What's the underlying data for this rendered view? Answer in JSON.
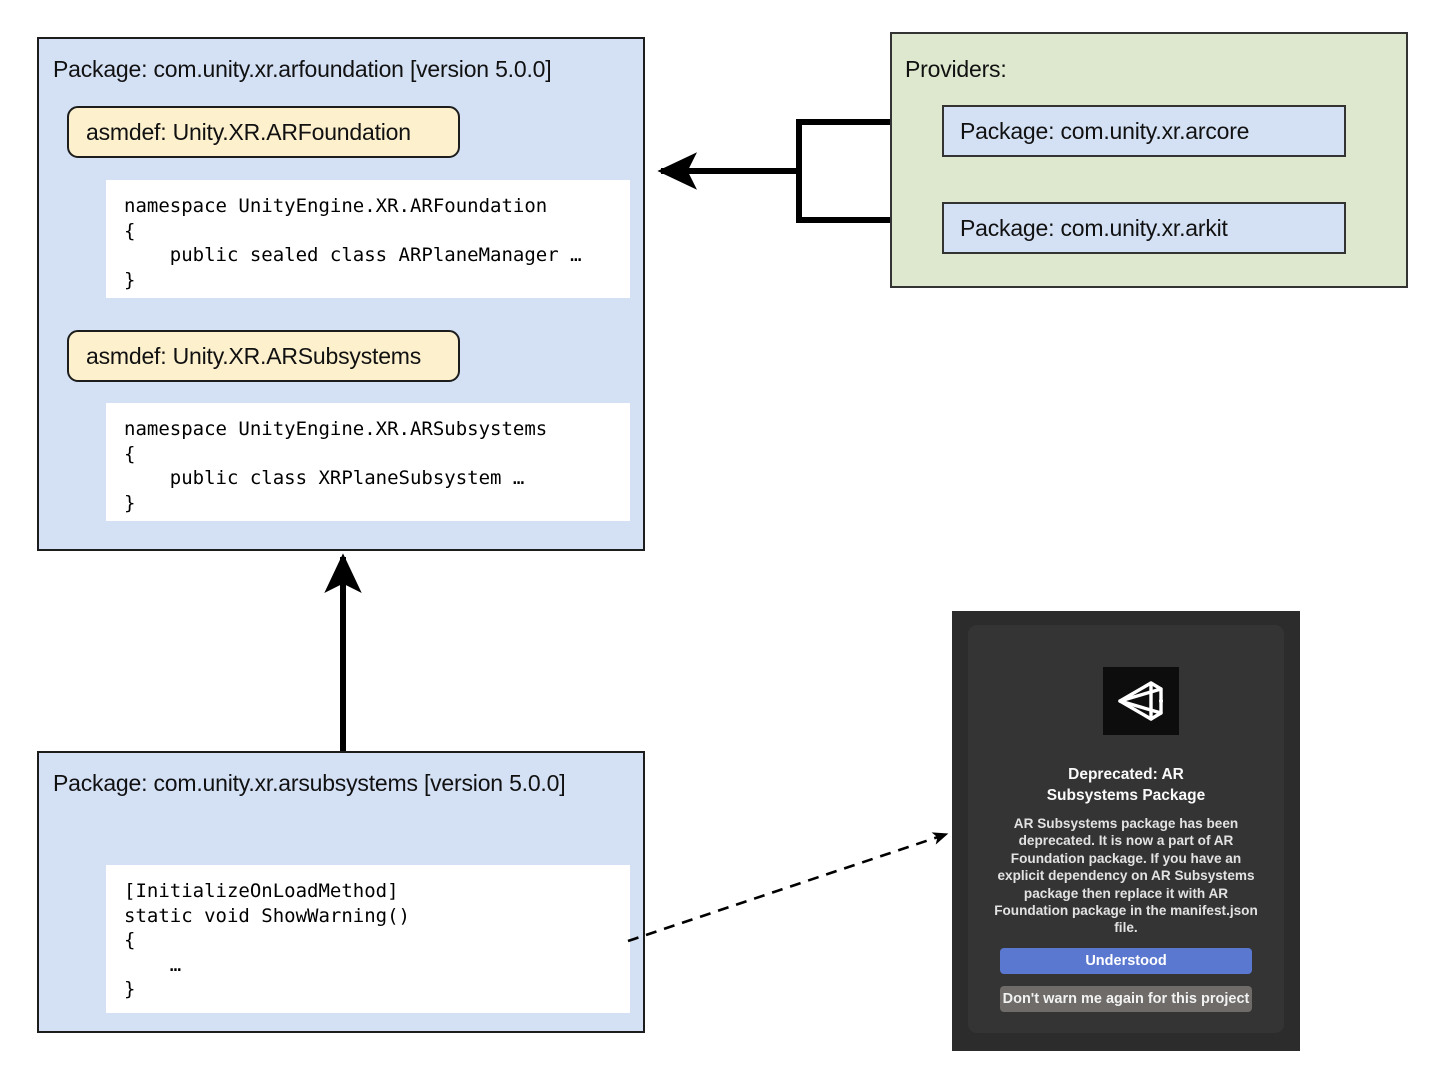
{
  "diagram": {
    "title_hidden": "",
    "arfoundation_package": {
      "title": "Package: com.unity.xr.arfoundation [version 5.0.0]",
      "asmdef_1": "asmdef: Unity.XR.ARFoundation",
      "code_1": "namespace UnityEngine.XR.ARFoundation\n{\n    public sealed class ARPlaneManager …\n}",
      "asmdef_2": "asmdef: Unity.XR.ARSubsystems",
      "code_2": "namespace UnityEngine.XR.ARSubsystems\n{\n    public class XRPlaneSubsystem …\n}"
    },
    "arsubsystems_package": {
      "title": "Package: com.unity.xr.arsubsystems [version 5.0.0]",
      "code": "[InitializeOnLoadMethod]\nstatic void ShowWarning()\n{\n    …\n}"
    },
    "providers": {
      "title": "Providers:",
      "packages": [
        "Package: com.unity.xr.arcore",
        "Package: com.unity.xr.arkit"
      ]
    },
    "colors": {
      "package_fill": "#d4e1f5",
      "providers_fill": "#dde8ce",
      "asmdef_fill": "#fcf0cd",
      "code_fill": "#ffffff",
      "stroke": "#1d1d1d",
      "dialog_bg": "#2c2c2c",
      "dialog_panel": "#343434",
      "primary_button": "#5a78d0",
      "secondary_button": "#6e6b69"
    }
  },
  "unity_dialog": {
    "logo_icon": "unity-logo-icon",
    "title": "Deprecated: AR\nSubsystems Package",
    "title_line_1": "Deprecated: AR",
    "title_line_2": "Subsystems Package",
    "body": "AR Subsystems package has been deprecated. It is now a part of AR Foundation package. If you have an explicit dependency on AR Subsystems package then replace it with AR Foundation package in the manifest.json file.",
    "primary_button_label": "Understood",
    "secondary_button_label": "Don't warn me again for this project"
  }
}
